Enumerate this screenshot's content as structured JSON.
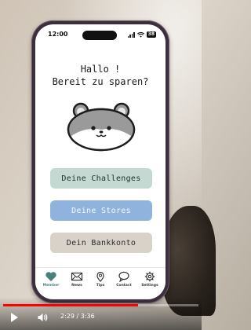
{
  "status_bar": {
    "time": "12:00",
    "battery": "38"
  },
  "greeting": {
    "line1": "Hallo !",
    "line2": "Bereit zu sparen?"
  },
  "buttons": {
    "challenges": "Deine Challenges",
    "stores": "Deine Stores",
    "bank": "Dein Bankkonto"
  },
  "tabs": [
    {
      "label": "Member",
      "icon": "heart-icon",
      "active": true
    },
    {
      "label": "News",
      "icon": "mail-icon"
    },
    {
      "label": "Tips",
      "icon": "map-pin-icon"
    },
    {
      "label": "Contact",
      "icon": "chat-bubble-icon"
    },
    {
      "label": "Settings",
      "icon": "gear-icon"
    }
  ],
  "video_player": {
    "current_time": "2:29",
    "duration": "3:36",
    "time_display": "2:29 / 3:36",
    "progress": 0.69
  },
  "colors": {
    "challenges_button": "#c4d9d2",
    "stores_button": "#8fb3dc",
    "bank_button": "#d8d2c9",
    "active_tab": "#4a7f7a",
    "progress": "#ff0000"
  }
}
